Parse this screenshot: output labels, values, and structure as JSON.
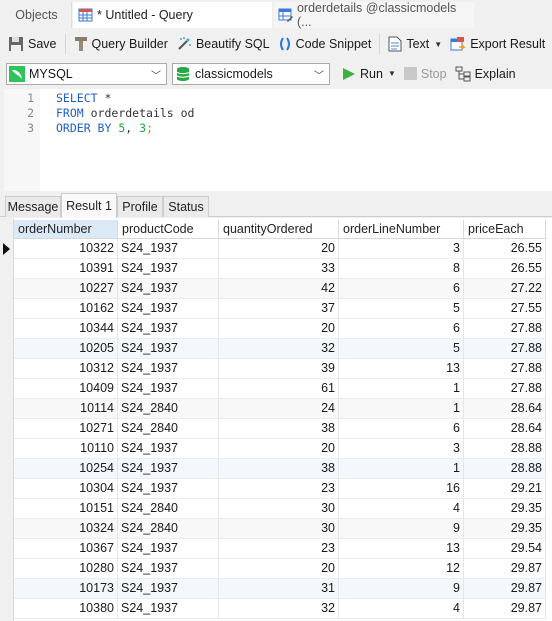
{
  "tabs": {
    "objects": "Objects",
    "query": "* Untitled - Query",
    "orderdetails": "orderdetails @classicmodels (..."
  },
  "toolbar": {
    "save": "Save",
    "query_builder": "Query Builder",
    "beautify_sql": "Beautify SQL",
    "code_snippet": "Code Snippet",
    "text": "Text",
    "export_result": "Export Result"
  },
  "connection": {
    "server": "MYSQL",
    "database": "classicmodels",
    "run": "Run",
    "stop": "Stop",
    "explain": "Explain"
  },
  "editor": {
    "lines": [
      {
        "n": "1",
        "tokens": [
          {
            "t": "SELECT",
            "c": "kw"
          },
          {
            "t": " *",
            "c": ""
          }
        ]
      },
      {
        "n": "2",
        "tokens": [
          {
            "t": "FROM",
            "c": "kw"
          },
          {
            "t": " orderdetails od",
            "c": ""
          }
        ]
      },
      {
        "n": "3",
        "tokens": [
          {
            "t": "ORDER BY",
            "c": "kw"
          },
          {
            "t": " ",
            "c": ""
          },
          {
            "t": "5",
            "c": "num"
          },
          {
            "t": ", ",
            "c": ""
          },
          {
            "t": "3",
            "c": "num"
          },
          {
            "t": ";",
            "c": "punct"
          }
        ]
      }
    ]
  },
  "result_tabs": [
    "Message",
    "Result 1",
    "Profile",
    "Status"
  ],
  "active_result_tab": "Result 1",
  "grid": {
    "columns": [
      "orderNumber",
      "productCode",
      "quantityOrdered",
      "orderLineNumber",
      "priceEach"
    ],
    "rows": [
      [
        "10322",
        "S24_1937",
        "20",
        "3",
        "26.55"
      ],
      [
        "10391",
        "S24_1937",
        "33",
        "8",
        "26.55"
      ],
      [
        "10227",
        "S24_1937",
        "42",
        "6",
        "27.22"
      ],
      [
        "10162",
        "S24_1937",
        "37",
        "5",
        "27.55"
      ],
      [
        "10344",
        "S24_1937",
        "20",
        "6",
        "27.88"
      ],
      [
        "10205",
        "S24_1937",
        "32",
        "5",
        "27.88"
      ],
      [
        "10312",
        "S24_1937",
        "39",
        "13",
        "27.88"
      ],
      [
        "10409",
        "S24_1937",
        "61",
        "1",
        "27.88"
      ],
      [
        "10114",
        "S24_2840",
        "24",
        "1",
        "28.64"
      ],
      [
        "10271",
        "S24_2840",
        "38",
        "6",
        "28.64"
      ],
      [
        "10110",
        "S24_1937",
        "20",
        "3",
        "28.88"
      ],
      [
        "10254",
        "S24_1937",
        "38",
        "1",
        "28.88"
      ],
      [
        "10304",
        "S24_1937",
        "23",
        "16",
        "29.21"
      ],
      [
        "10151",
        "S24_2840",
        "30",
        "4",
        "29.35"
      ],
      [
        "10324",
        "S24_2840",
        "30",
        "9",
        "29.35"
      ],
      [
        "10367",
        "S24_1937",
        "23",
        "13",
        "29.54"
      ],
      [
        "10280",
        "S24_1937",
        "20",
        "12",
        "29.87"
      ],
      [
        "10173",
        "S24_1937",
        "31",
        "9",
        "29.87"
      ],
      [
        "10380",
        "S24_1937",
        "32",
        "4",
        "29.87"
      ]
    ]
  }
}
